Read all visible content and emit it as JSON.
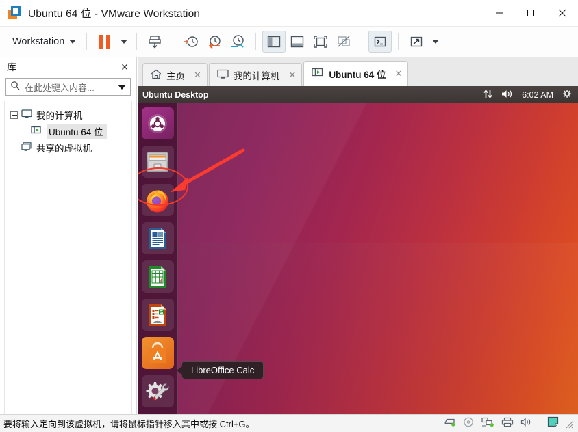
{
  "window": {
    "title": "Ubuntu 64 位 - VMware Workstation",
    "icon": "vmware-logo-icon",
    "minimize_label": "—",
    "maximize_label": "□",
    "close_label": "✕"
  },
  "toolbar": {
    "workstation_menu": "Workstation",
    "items": [
      {
        "name": "pause-vm-button",
        "label": "Pause"
      },
      {
        "name": "pause-dropdown-button",
        "label": ""
      },
      {
        "name": "manage-snapshot-button",
        "label": "Snapshot"
      },
      {
        "name": "take-snapshot-button",
        "label": "Take snapshot"
      },
      {
        "name": "revert-snapshot-button",
        "label": "Revert snapshot"
      },
      {
        "name": "snapshot-manager-button",
        "label": "Snapshot manager"
      },
      {
        "name": "show-left-pane-button",
        "label": "Show library"
      },
      {
        "name": "show-bottom-pane-button",
        "label": "Show thumbnail bar"
      },
      {
        "name": "fullscreen-button",
        "label": "Enter full screen"
      },
      {
        "name": "unity-mode-button",
        "label": "Unity mode"
      },
      {
        "name": "console-button",
        "label": "Console view"
      },
      {
        "name": "stretch-button",
        "label": "Stretch guest"
      },
      {
        "name": "stretch-dropdown-button",
        "label": ""
      }
    ]
  },
  "library": {
    "title": "库",
    "close_label": "✕",
    "search": {
      "placeholder": "在此处键入内容...",
      "value": ""
    },
    "tree": [
      {
        "label": "我的计算机",
        "icon": "monitor-icon",
        "level": 0,
        "expanded": true,
        "selected": false
      },
      {
        "label": "Ubuntu 64 位",
        "icon": "vm-running-icon",
        "level": 1,
        "expanded": false,
        "selected": true
      },
      {
        "label": "共享的虚拟机",
        "icon": "shared-vm-icon",
        "level": 0,
        "expanded": false,
        "selected": false
      }
    ]
  },
  "tabs": [
    {
      "label": "主页",
      "icon": "home-icon",
      "active": false,
      "close_label": "✕"
    },
    {
      "label": "我的计算机",
      "icon": "monitor-icon",
      "active": false,
      "close_label": "✕"
    },
    {
      "label": "Ubuntu 64 位",
      "icon": "vm-running-icon",
      "active": true,
      "close_label": "✕"
    }
  ],
  "vm": {
    "topbar": {
      "title": "Ubuntu Desktop",
      "network_icon": "network-updown-icon",
      "volume_icon": "volume-icon",
      "clock": "6:02 AM",
      "settings_icon": "gear-icon"
    },
    "dock": [
      {
        "name": "dock-item-dash-home",
        "label": "Dash Home",
        "icon": "ubuntu-logo-icon"
      },
      {
        "name": "dock-item-files",
        "label": "Files",
        "icon": "file-cabinet-icon"
      },
      {
        "name": "dock-item-firefox",
        "label": "Firefox Web Browser",
        "icon": "firefox-icon",
        "highlighted": true
      },
      {
        "name": "dock-item-libreoffice-writer",
        "label": "LibreOffice Writer",
        "icon": "libreoffice-writer-icon"
      },
      {
        "name": "dock-item-libreoffice-calc",
        "label": "LibreOffice Calc",
        "icon": "libreoffice-calc-icon"
      },
      {
        "name": "dock-item-libreoffice-impress",
        "label": "LibreOffice Impress",
        "icon": "libreoffice-impress-icon"
      },
      {
        "name": "dock-item-software-center",
        "label": "Ubuntu Software",
        "icon": "software-bag-icon"
      },
      {
        "name": "dock-item-system-settings",
        "label": "System Settings",
        "icon": "gear-wrench-icon"
      }
    ],
    "tooltip": "LibreOffice Calc",
    "annotation": {
      "highlight_color": "#f0392b",
      "arrow_color": "#fb3b30",
      "target": "dock-item-firefox"
    }
  },
  "statusbar": {
    "message": "要将输入定向到该虚拟机，请将鼠标指针移入其中或按 Ctrl+G。",
    "icons": [
      {
        "name": "hard-disk-status-icon",
        "label": "Hard Disk"
      },
      {
        "name": "cd-dvd-status-icon",
        "label": "CD/DVD"
      },
      {
        "name": "network-status-icon",
        "label": "Network Adapter"
      },
      {
        "name": "printer-status-icon",
        "label": "Printer"
      },
      {
        "name": "sound-status-icon",
        "label": "Sound Card"
      },
      {
        "name": "display-status-icon",
        "label": "Display"
      }
    ]
  }
}
